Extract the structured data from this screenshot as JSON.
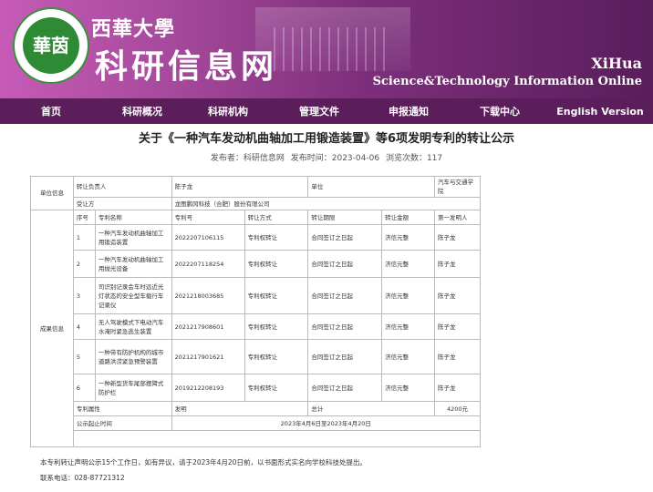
{
  "header": {
    "logo_text": "華茵",
    "brand_line1": "西華大學",
    "brand_line2": "科研信息网",
    "english_name": "XiHua",
    "english_tagline": "Science&Technology Information Online"
  },
  "nav": [
    "首页",
    "科研概况",
    "科研机构",
    "管理文件",
    "申报通知",
    "下载中心",
    "English Version"
  ],
  "article": {
    "title": "关于《一种汽车发动机曲轴加工用锻造装置》等6项发明专利的转让公示",
    "publisher": "发布者：科研信息网",
    "publish_time": "发布时间：2023-04-06",
    "views": "浏览次数：117"
  },
  "table": {
    "unit_info_label": "单位信息",
    "transferor_label": "转让负责人",
    "transferor": "陈子龙",
    "unit_label": "单位",
    "unit": "汽车与交通学院",
    "transferee_label": "受让方",
    "transferee": "龙图鹏冈科技（合肥）股份有限公司",
    "result_label": "成果信息",
    "headers": [
      "序号",
      "专利名称",
      "专利号",
      "转让方式",
      "转让期限",
      "转让金额",
      "第一发明人"
    ],
    "rows": [
      {
        "no": "1",
        "name": "一种汽车发动机曲轴加工用锻造装置",
        "patent": "2022207106115",
        "mode": "专利权转让",
        "term": "合同签订之日起",
        "amount": "济信元整",
        "inventor": "陈子龙"
      },
      {
        "no": "2",
        "name": "一种汽车发动机曲轴加工用抛光设备",
        "patent": "2022207118254",
        "mode": "专利权转让",
        "term": "合同签订之日起",
        "amount": "济信元整",
        "inventor": "陈子龙"
      },
      {
        "no": "3",
        "name": "司识别记录会车时远近光灯状态的安全型车载行车记录仪",
        "patent": "2021218003685",
        "mode": "专利权转让",
        "term": "合同签订之日起",
        "amount": "济信元整",
        "inventor": "陈子龙"
      },
      {
        "no": "4",
        "name": "无人驾驶模式下电动汽车水淹时紧急逃生装置",
        "patent": "2021217908601",
        "mode": "专利权转让",
        "term": "合同签订之日起",
        "amount": "济信元整",
        "inventor": "陈子龙"
      },
      {
        "no": "5",
        "name": "一种带有防护机构的城市道路洪涝紧急预警装置",
        "patent": "2021217901621",
        "mode": "专利权转让",
        "term": "合同签订之日起",
        "amount": "济信元整",
        "inventor": "陈子龙"
      },
      {
        "no": "6",
        "name": "一种新型货车尾部摆臂式防护栏",
        "patent": "2019212208193",
        "mode": "专利权转让",
        "term": "合同签订之日起",
        "amount": "济信元整",
        "inventor": "陈子龙"
      }
    ],
    "attr_label": "专利属性",
    "attr_value": "发明",
    "total_label": "总计",
    "total_value": "4200元",
    "period_label": "公示起止时间",
    "period_value": "2023年4月6日至2023年4月20日"
  },
  "footer": {
    "notice": "本专利转让声明公示15个工作日，如有异议，请于2023年4月20日前，以书面形式实名向学校科技处提出。",
    "contact": "联系电话：028-87721312"
  }
}
